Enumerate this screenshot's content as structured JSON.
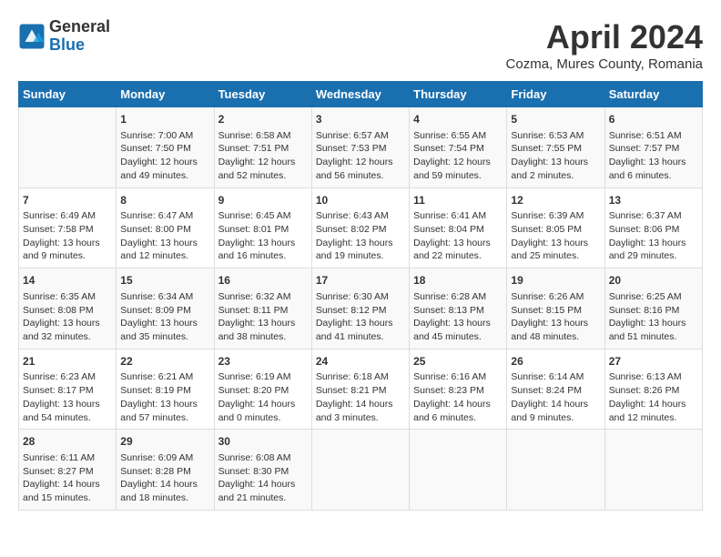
{
  "header": {
    "logo_general": "General",
    "logo_blue": "Blue",
    "month_title": "April 2024",
    "location": "Cozma, Mures County, Romania"
  },
  "days_of_week": [
    "Sunday",
    "Monday",
    "Tuesday",
    "Wednesday",
    "Thursday",
    "Friday",
    "Saturday"
  ],
  "weeks": [
    [
      {
        "day": "",
        "info": ""
      },
      {
        "day": "1",
        "info": "Sunrise: 7:00 AM\nSunset: 7:50 PM\nDaylight: 12 hours\nand 49 minutes."
      },
      {
        "day": "2",
        "info": "Sunrise: 6:58 AM\nSunset: 7:51 PM\nDaylight: 12 hours\nand 52 minutes."
      },
      {
        "day": "3",
        "info": "Sunrise: 6:57 AM\nSunset: 7:53 PM\nDaylight: 12 hours\nand 56 minutes."
      },
      {
        "day": "4",
        "info": "Sunrise: 6:55 AM\nSunset: 7:54 PM\nDaylight: 12 hours\nand 59 minutes."
      },
      {
        "day": "5",
        "info": "Sunrise: 6:53 AM\nSunset: 7:55 PM\nDaylight: 13 hours\nand 2 minutes."
      },
      {
        "day": "6",
        "info": "Sunrise: 6:51 AM\nSunset: 7:57 PM\nDaylight: 13 hours\nand 6 minutes."
      }
    ],
    [
      {
        "day": "7",
        "info": "Sunrise: 6:49 AM\nSunset: 7:58 PM\nDaylight: 13 hours\nand 9 minutes."
      },
      {
        "day": "8",
        "info": "Sunrise: 6:47 AM\nSunset: 8:00 PM\nDaylight: 13 hours\nand 12 minutes."
      },
      {
        "day": "9",
        "info": "Sunrise: 6:45 AM\nSunset: 8:01 PM\nDaylight: 13 hours\nand 16 minutes."
      },
      {
        "day": "10",
        "info": "Sunrise: 6:43 AM\nSunset: 8:02 PM\nDaylight: 13 hours\nand 19 minutes."
      },
      {
        "day": "11",
        "info": "Sunrise: 6:41 AM\nSunset: 8:04 PM\nDaylight: 13 hours\nand 22 minutes."
      },
      {
        "day": "12",
        "info": "Sunrise: 6:39 AM\nSunset: 8:05 PM\nDaylight: 13 hours\nand 25 minutes."
      },
      {
        "day": "13",
        "info": "Sunrise: 6:37 AM\nSunset: 8:06 PM\nDaylight: 13 hours\nand 29 minutes."
      }
    ],
    [
      {
        "day": "14",
        "info": "Sunrise: 6:35 AM\nSunset: 8:08 PM\nDaylight: 13 hours\nand 32 minutes."
      },
      {
        "day": "15",
        "info": "Sunrise: 6:34 AM\nSunset: 8:09 PM\nDaylight: 13 hours\nand 35 minutes."
      },
      {
        "day": "16",
        "info": "Sunrise: 6:32 AM\nSunset: 8:11 PM\nDaylight: 13 hours\nand 38 minutes."
      },
      {
        "day": "17",
        "info": "Sunrise: 6:30 AM\nSunset: 8:12 PM\nDaylight: 13 hours\nand 41 minutes."
      },
      {
        "day": "18",
        "info": "Sunrise: 6:28 AM\nSunset: 8:13 PM\nDaylight: 13 hours\nand 45 minutes."
      },
      {
        "day": "19",
        "info": "Sunrise: 6:26 AM\nSunset: 8:15 PM\nDaylight: 13 hours\nand 48 minutes."
      },
      {
        "day": "20",
        "info": "Sunrise: 6:25 AM\nSunset: 8:16 PM\nDaylight: 13 hours\nand 51 minutes."
      }
    ],
    [
      {
        "day": "21",
        "info": "Sunrise: 6:23 AM\nSunset: 8:17 PM\nDaylight: 13 hours\nand 54 minutes."
      },
      {
        "day": "22",
        "info": "Sunrise: 6:21 AM\nSunset: 8:19 PM\nDaylight: 13 hours\nand 57 minutes."
      },
      {
        "day": "23",
        "info": "Sunrise: 6:19 AM\nSunset: 8:20 PM\nDaylight: 14 hours\nand 0 minutes."
      },
      {
        "day": "24",
        "info": "Sunrise: 6:18 AM\nSunset: 8:21 PM\nDaylight: 14 hours\nand 3 minutes."
      },
      {
        "day": "25",
        "info": "Sunrise: 6:16 AM\nSunset: 8:23 PM\nDaylight: 14 hours\nand 6 minutes."
      },
      {
        "day": "26",
        "info": "Sunrise: 6:14 AM\nSunset: 8:24 PM\nDaylight: 14 hours\nand 9 minutes."
      },
      {
        "day": "27",
        "info": "Sunrise: 6:13 AM\nSunset: 8:26 PM\nDaylight: 14 hours\nand 12 minutes."
      }
    ],
    [
      {
        "day": "28",
        "info": "Sunrise: 6:11 AM\nSunset: 8:27 PM\nDaylight: 14 hours\nand 15 minutes."
      },
      {
        "day": "29",
        "info": "Sunrise: 6:09 AM\nSunset: 8:28 PM\nDaylight: 14 hours\nand 18 minutes."
      },
      {
        "day": "30",
        "info": "Sunrise: 6:08 AM\nSunset: 8:30 PM\nDaylight: 14 hours\nand 21 minutes."
      },
      {
        "day": "",
        "info": ""
      },
      {
        "day": "",
        "info": ""
      },
      {
        "day": "",
        "info": ""
      },
      {
        "day": "",
        "info": ""
      }
    ]
  ]
}
